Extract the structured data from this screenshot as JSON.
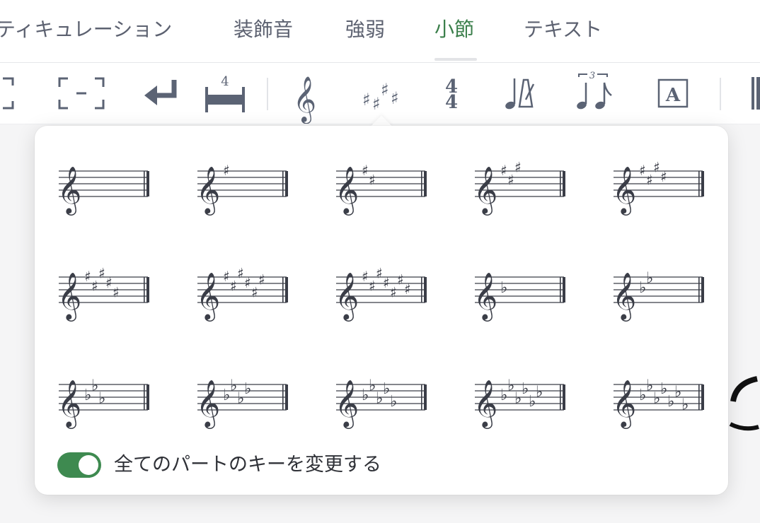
{
  "tabs": [
    {
      "label": "ティキュレーション",
      "active": false
    },
    {
      "label": "装飾音",
      "active": false
    },
    {
      "label": "強弱",
      "active": false
    },
    {
      "label": "小節",
      "active": true
    },
    {
      "label": "テキスト",
      "active": false
    }
  ],
  "toolbar": {
    "items": [
      {
        "icon": "repeat-bracket-icon"
      },
      {
        "icon": "dashed-bracket-icon"
      },
      {
        "icon": "line-break-icon"
      },
      {
        "icon": "multi-measure-rest-icon",
        "label": "4"
      },
      {
        "icon": "treble-clef-icon"
      },
      {
        "icon": "key-signature-icon"
      },
      {
        "icon": "time-signature-icon",
        "label": "4/4"
      },
      {
        "icon": "metronome-tempo-icon"
      },
      {
        "icon": "tuplet-icon",
        "label": "3"
      },
      {
        "icon": "text-box-icon",
        "label": "A"
      },
      {
        "icon": "barline-icon"
      }
    ]
  },
  "key_signatures": [
    {
      "accidental": "sharp",
      "count": 0
    },
    {
      "accidental": "sharp",
      "count": 1
    },
    {
      "accidental": "sharp",
      "count": 2
    },
    {
      "accidental": "sharp",
      "count": 3
    },
    {
      "accidental": "sharp",
      "count": 4
    },
    {
      "accidental": "sharp",
      "count": 5
    },
    {
      "accidental": "sharp",
      "count": 6
    },
    {
      "accidental": "sharp",
      "count": 7
    },
    {
      "accidental": "flat",
      "count": 1
    },
    {
      "accidental": "flat",
      "count": 2
    },
    {
      "accidental": "flat",
      "count": 3
    },
    {
      "accidental": "flat",
      "count": 4
    },
    {
      "accidental": "flat",
      "count": 5
    },
    {
      "accidental": "flat",
      "count": 6
    },
    {
      "accidental": "flat",
      "count": 7
    }
  ],
  "toggle": {
    "label": "全てのパートのキーを変更する",
    "on": true
  },
  "colors": {
    "accent": "#3e8a50",
    "tab_active": "#3b7f4b",
    "notation": "#3a3d47",
    "icon": "#5b6374"
  }
}
